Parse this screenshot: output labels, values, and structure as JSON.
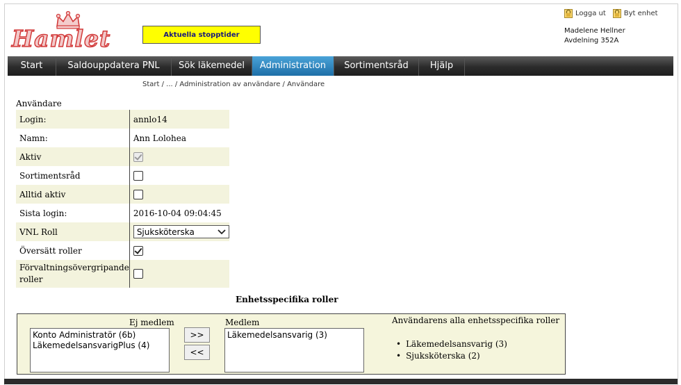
{
  "logo": {
    "text": "Hamlet"
  },
  "header": {
    "stop_button": "Aktuella stopptider",
    "logout": "Logga ut",
    "switch_unit": "Byt enhet",
    "user_name": "Madelene Hellner",
    "unit": "Avdelning 352A"
  },
  "nav": {
    "items": [
      {
        "label": "Start"
      },
      {
        "label": "Saldouppdatera PNL"
      },
      {
        "label": "Sök läkemedel"
      },
      {
        "label": "Administration"
      },
      {
        "label": "Sortimentsråd"
      },
      {
        "label": "Hjälp"
      }
    ],
    "active": "Administration"
  },
  "breadcrumb": "Start / ... / Administration av användare / Användare",
  "form": {
    "section_title": "Användare",
    "login_label": "Login:",
    "login_value": "annlo14",
    "name_label": "Namn:",
    "name_value": "Ann Lolohea",
    "active_label": "Aktiv",
    "active_checked": true,
    "sortiment_label": "Sortimentsråd",
    "sortiment_checked": false,
    "always_active_label": "Alltid aktiv",
    "always_active_checked": false,
    "last_login_label": "Sista login:",
    "last_login_value": "2016-10-04 09:04:45",
    "vnl_label": "VNL Roll",
    "vnl_value": "Sjuksköterska",
    "override_label": "Översätt roller",
    "override_checked": true,
    "admin_cross_label_1": "Förvaltningsövergripande",
    "admin_cross_label_2": "roller",
    "admin_cross_checked": false
  },
  "roles": {
    "title": "Enhetsspecifika roller",
    "not_member_label": "Ej medlem",
    "member_label": "Medlem",
    "all_label": "Användarens alla enhetsspecifika roller",
    "not_member_items": [
      "Konto Administratör (6b)",
      "LäkemedelsansvarigPlus (4)"
    ],
    "member_items": [
      "Läkemedelsansvarig (3)"
    ],
    "add_button": ">>",
    "remove_button": "<<",
    "all_roles": [
      "Läkemedelsansvarig (3)",
      "Sjuksköterska (2)"
    ]
  },
  "colors": {
    "nav_active": "#2e86c1",
    "stop_button_bg": "#ffff00",
    "form_row_alt": "#f3f3dd",
    "roles_bg": "#f5f5dc",
    "logo": "#d23a3a"
  }
}
